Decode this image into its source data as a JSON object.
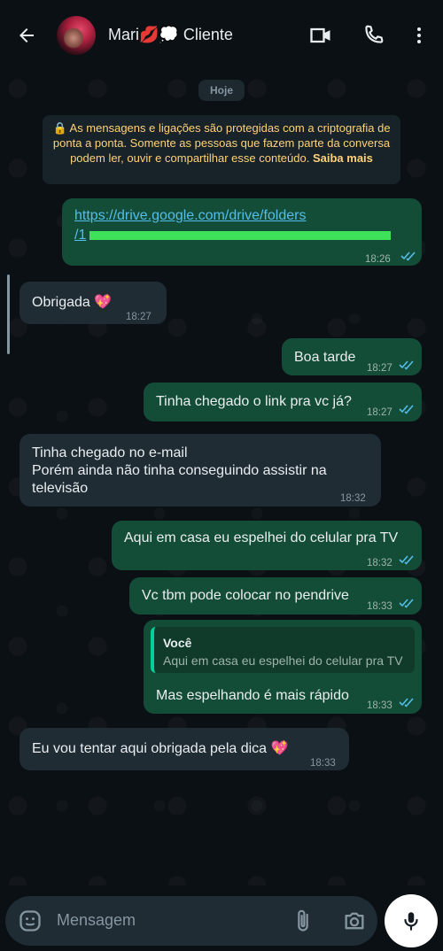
{
  "header": {
    "contact_name": "Mari💋💭 Cliente",
    "icons": [
      "back-arrow-icon",
      "video-call-icon",
      "phone-call-icon",
      "more-vertical-icon"
    ]
  },
  "chat": {
    "date_chip": "Hoje",
    "encryption_notice": "🔒 As mensagens e ligações são protegidas com a criptografia de ponta a ponta. Somente as pessoas que fazem parte da conversa podem ler, ouvir e compartilhar esse conteúdo.",
    "encryption_more": "Saiba mais",
    "messages": [
      {
        "direction": "out",
        "text_line1": "https://drive.google.com/drive/folders",
        "text_line2": "/1",
        "time": "18:26",
        "status": "read"
      },
      {
        "direction": "in",
        "text": "Obrigada 💖",
        "time": "18:27"
      },
      {
        "direction": "out",
        "text": "Boa tarde",
        "time": "18:27",
        "status": "read"
      },
      {
        "direction": "out",
        "text": "Tinha chegado o link pra vc já?",
        "time": "18:27",
        "status": "read"
      },
      {
        "direction": "in",
        "lines": [
          "Tinha chegado no e-mail",
          "Porém ainda não tinha conseguindo assistir na",
          "televisão"
        ],
        "time": "18:32"
      },
      {
        "direction": "out",
        "text": "Aqui em casa eu espelhei do celular pra TV",
        "time": "18:32",
        "status": "read"
      },
      {
        "direction": "out",
        "text": "Vc tbm pode colocar no pendrive",
        "time": "18:33",
        "status": "read"
      },
      {
        "direction": "out",
        "quote_author": "Você",
        "quote_text": "Aqui em casa eu espelhei do celular pra TV",
        "text": "Mas espelhando é mais rápido",
        "time": "18:33",
        "status": "read"
      },
      {
        "direction": "in",
        "text": "Eu vou tentar aqui obrigada pela dica 💖",
        "time": "18:33"
      }
    ]
  },
  "composer": {
    "placeholder": "Mensagem",
    "icons": [
      "sticker-icon",
      "attach-clip-icon",
      "camera-icon",
      "microphone-icon"
    ]
  },
  "colors": {
    "background": "#0b1014",
    "outgoing_bubble": "#144d37",
    "incoming_bubble": "#1f2c34",
    "accent": "#06cf9c",
    "link": "#53bdeb",
    "read_ticks": "#53bdeb",
    "notice_text": "#ffd279"
  }
}
